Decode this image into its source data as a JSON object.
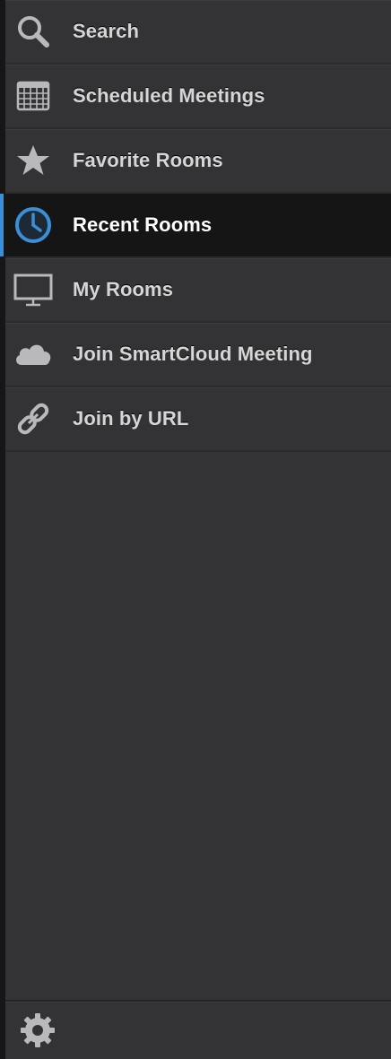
{
  "sidebar": {
    "items": [
      {
        "label": "Search",
        "icon": "search-icon",
        "active": false
      },
      {
        "label": "Scheduled Meetings",
        "icon": "calendar-icon",
        "active": false
      },
      {
        "label": "Favorite Rooms",
        "icon": "star-icon",
        "active": false
      },
      {
        "label": "Recent Rooms",
        "icon": "clock-icon",
        "active": true
      },
      {
        "label": "My Rooms",
        "icon": "screen-icon",
        "active": false
      },
      {
        "label": "Join SmartCloud Meeting",
        "icon": "cloud-icon",
        "active": false
      },
      {
        "label": "Join by URL",
        "icon": "link-icon",
        "active": false
      }
    ],
    "footer": {
      "settings_icon": "gear-icon"
    }
  },
  "colors": {
    "background": "#333336",
    "active_background": "#151515",
    "active_accent": "#3b8fd6",
    "text": "#d6d6d6",
    "icon": "#b9b9bb"
  }
}
